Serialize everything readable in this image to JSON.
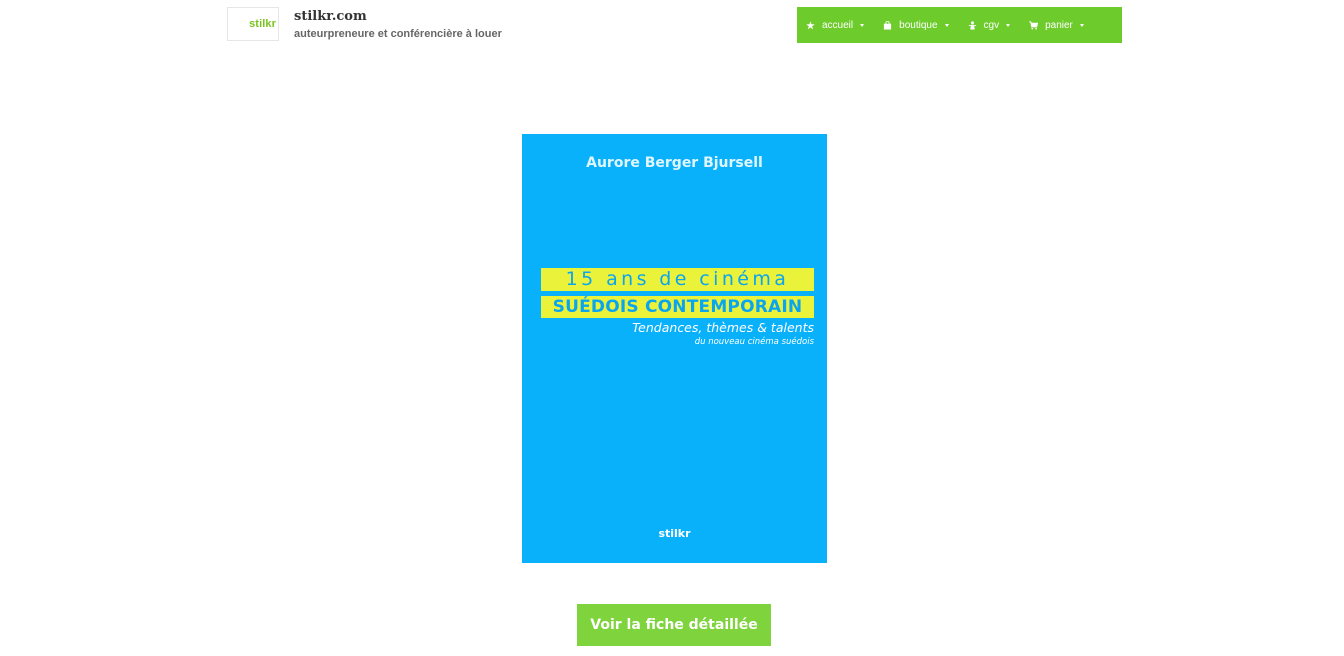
{
  "header": {
    "logo_text": "stilkr",
    "site_title": "stilkr.com",
    "tagline": "auteurpreneure et conférencière à louer"
  },
  "nav": {
    "items": [
      {
        "label": "accueil",
        "icon": "star-icon"
      },
      {
        "label": "boutique",
        "icon": "shopping-bag-icon"
      },
      {
        "label": "cgv",
        "icon": "legal-document-icon"
      },
      {
        "label": "panier",
        "icon": "cart-icon"
      }
    ]
  },
  "cover": {
    "author": "Aurore Berger Bjursell",
    "title_line1": "15 ans de cinéma",
    "title_line2": "SUÉDOIS CONTEMPORAIN",
    "subtitle_line1": "Tendances, thèmes & talents",
    "subtitle_line2": "du nouveau cinéma suédois",
    "publisher": "stilkr"
  },
  "cta": {
    "label": "Voir la fiche détaillée"
  },
  "colors": {
    "brand_green": "#6ecb2c",
    "button_green": "#7fd43e",
    "cover_blue": "#09b1fb",
    "highlight_yellow": "#eaf339"
  }
}
